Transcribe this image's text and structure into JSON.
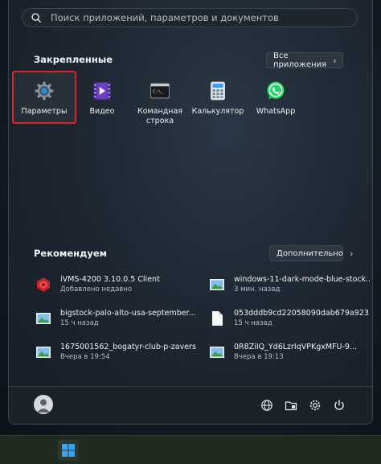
{
  "search": {
    "placeholder": "Поиск приложений, параметров и документов"
  },
  "pinned": {
    "title": "Закрепленные",
    "all_apps_label": "Все приложения",
    "apps": [
      {
        "label": "Параметры",
        "icon": "settings-gear-icon"
      },
      {
        "label": "Видео",
        "icon": "video-film-icon"
      },
      {
        "label": "Командная строка",
        "icon": "command-prompt-icon"
      },
      {
        "label": "Калькулятор",
        "icon": "calculator-icon"
      },
      {
        "label": "WhatsApp",
        "icon": "whatsapp-icon"
      }
    ]
  },
  "recommended": {
    "title": "Рекомендуем",
    "more_label": "Дополнительно",
    "items": [
      {
        "name": "iVMS-4200 3.10.0.5 Client",
        "sub": "Добавлено недавно",
        "icon": "ivms-icon"
      },
      {
        "name": "windows-11-dark-mode-blue-stock...",
        "sub": "3 мин. назад",
        "icon": "image-file-icon"
      },
      {
        "name": "bigstock-palo-alto-usa-september...",
        "sub": "15 ч назад",
        "icon": "image-file-icon"
      },
      {
        "name": "053dddb9cd22058090dab679a923...",
        "sub": "15 ч назад",
        "icon": "document-file-icon"
      },
      {
        "name": "1675001562_bogatyr-club-p-zavers...",
        "sub": "Вчера в 19:54",
        "icon": "image-file-icon"
      },
      {
        "name": "0R8ZiIQ_Yd6LzrIqVPKgxMFU-9...",
        "sub": "Вчера в 19:13",
        "icon": "image-file-icon"
      }
    ]
  },
  "footer": {
    "icons": [
      "user-avatar-icon",
      "network-globe-icon",
      "file-explorer-icon",
      "settings-icon",
      "power-icon"
    ]
  },
  "colors": {
    "highlight": "#d8262c",
    "accent": "#0078d4"
  }
}
